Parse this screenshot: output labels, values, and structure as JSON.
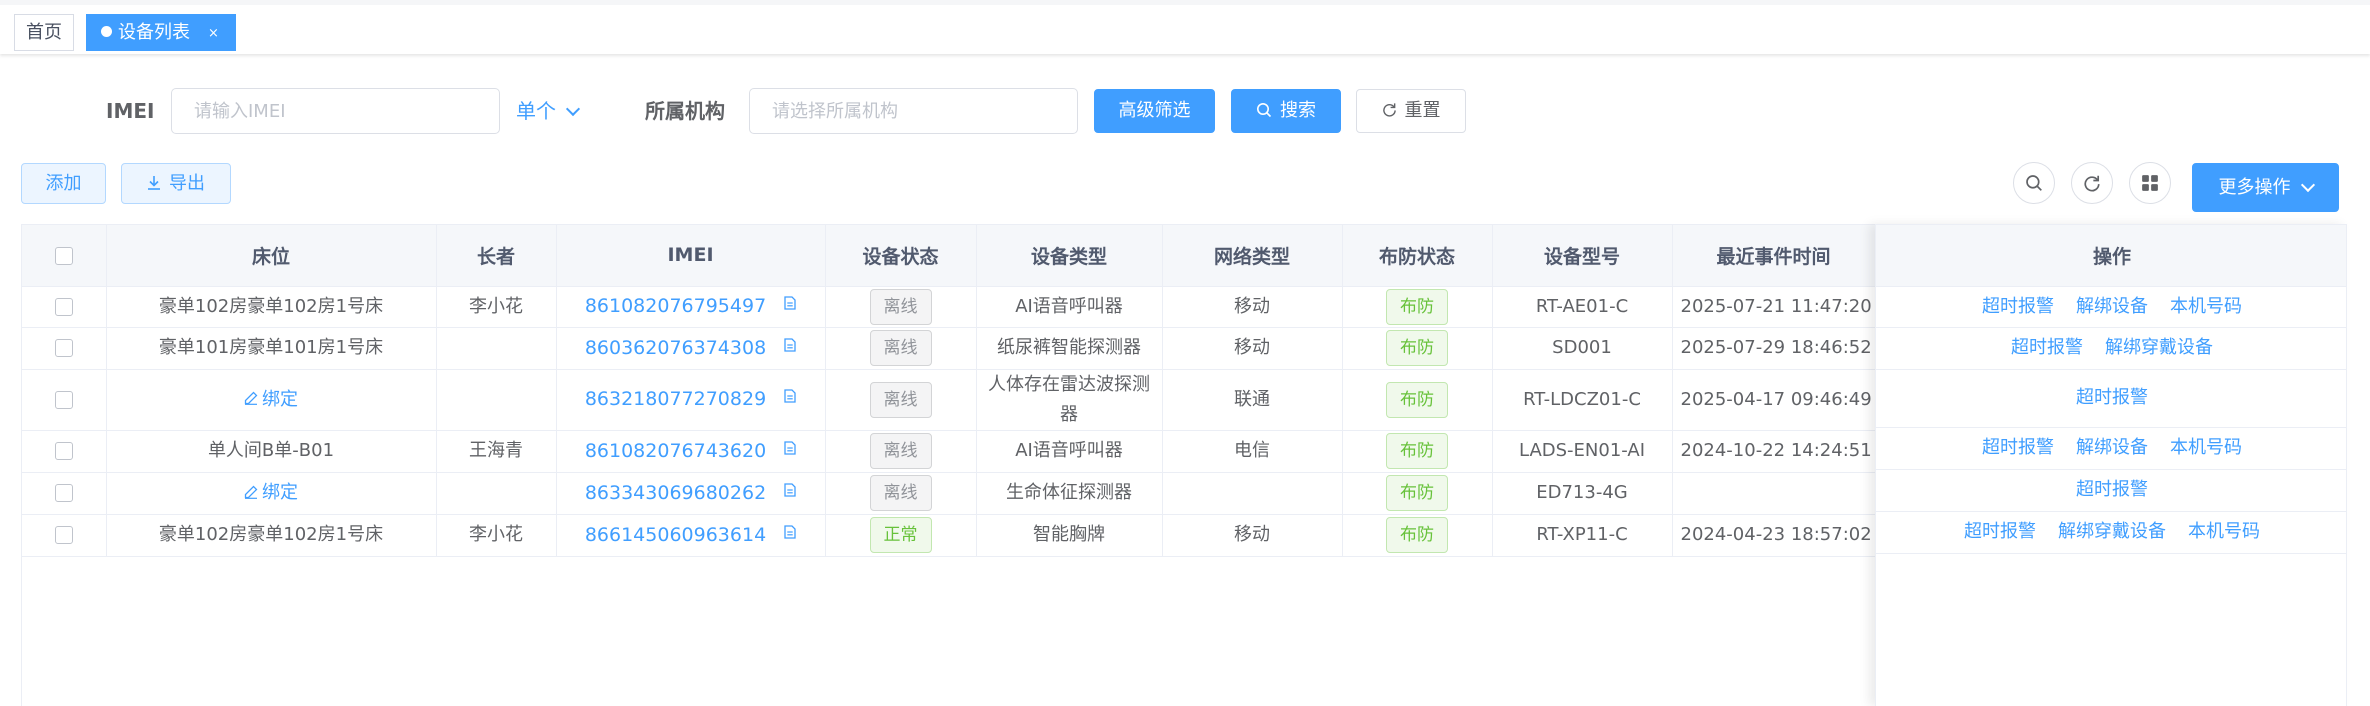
{
  "tabs": {
    "home": "首页",
    "active": "设备列表",
    "close": "×"
  },
  "filters": {
    "imei_label": "IMEI",
    "imei_placeholder": "请输入IMEI",
    "mode_select": "单个",
    "org_label": "所属机构",
    "org_placeholder": "请选择所属机构",
    "advanced_button": "高级筛选",
    "search_button": "搜索",
    "reset_button": "重置"
  },
  "toolbar": {
    "add_button": "添加",
    "export_button": "导出",
    "more_button": "更多操作"
  },
  "table": {
    "headers": {
      "bed": "床位",
      "elder": "长者",
      "imei": "IMEI",
      "device_status": "设备状态",
      "device_type": "设备类型",
      "network_type": "网络类型",
      "arm_status": "布防状态",
      "model": "设备型号",
      "last_event_time": "最近事件时间",
      "actions": "操作"
    },
    "rows": [
      {
        "bed": "豪单102房豪单102房1号床",
        "bind": "",
        "elder": "李小花",
        "imei": "861082076795497",
        "status": "离线",
        "type": "AI语音呼叫器",
        "network": "移动",
        "arm": "布防",
        "model": "RT-AE01-C",
        "time": "2025-07-21 11:47:20",
        "actions": [
          "超时报警",
          "解绑设备",
          "本机号码"
        ]
      },
      {
        "bed": "豪单101房豪单101房1号床",
        "bind": "",
        "elder": "",
        "imei": "860362076374308",
        "status": "离线",
        "type": "纸尿裤智能探测器",
        "network": "移动",
        "arm": "布防",
        "model": "SD001",
        "time": "2025-07-29 18:46:52",
        "actions": [
          "超时报警",
          "解绑穿戴设备"
        ]
      },
      {
        "bed": "",
        "bind": "绑定",
        "elder": "",
        "imei": "863218077270829",
        "status": "离线",
        "type": "人体存在雷达波探测器",
        "network": "联通",
        "arm": "布防",
        "model": "RT-LDCZ01-C",
        "time": "2025-04-17 09:46:49",
        "actions": [
          "超时报警"
        ]
      },
      {
        "bed": "单人间B单-B01",
        "bind": "",
        "elder": "王海青",
        "imei": "861082076743620",
        "status": "离线",
        "type": "AI语音呼叫器",
        "network": "电信",
        "arm": "布防",
        "model": "LADS-EN01-AI",
        "time": "2024-10-22 14:24:51",
        "actions": [
          "超时报警",
          "解绑设备",
          "本机号码"
        ]
      },
      {
        "bed": "",
        "bind": "绑定",
        "elder": "",
        "imei": "863343069680262",
        "status": "离线",
        "type": "生命体征探测器",
        "network": "",
        "arm": "布防",
        "model": "ED713-4G",
        "time": "",
        "actions": [
          "超时报警"
        ]
      },
      {
        "bed": "豪单102房豪单102房1号床",
        "bind": "",
        "elder": "李小花",
        "imei": "866145060963614",
        "status": "正常",
        "type": "智能胸牌",
        "network": "移动",
        "arm": "布防",
        "model": "RT-XP11-C",
        "time": "2024-04-23 18:57:02",
        "actions": [
          "超时报警",
          "解绑穿戴设备",
          "本机号码"
        ]
      }
    ]
  },
  "colors": {
    "primary": "#409eff",
    "status_offline": "#909399",
    "status_normal": "#67c23a",
    "arm_green": "#67c23a"
  },
  "icons": [
    "search-icon",
    "refresh-icon",
    "grid-icon",
    "download-icon",
    "document-icon",
    "edit-icon",
    "chevron-down-icon",
    "close-icon"
  ]
}
